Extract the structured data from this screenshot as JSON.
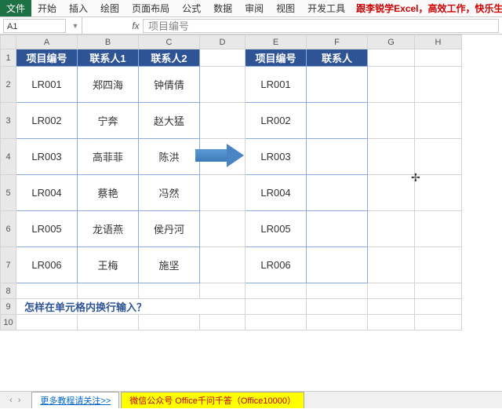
{
  "ribbon": {
    "tabs": [
      "文件",
      "开始",
      "插入",
      "绘图",
      "页面布局",
      "公式",
      "数据",
      "审阅",
      "视图",
      "开发工具"
    ],
    "extra": "跟李锐学Excel，高效工作，快乐生活！"
  },
  "namebox": {
    "cell": "A1",
    "fx": "fx",
    "formula": "项目编号"
  },
  "columns": [
    "A",
    "B",
    "C",
    "D",
    "E",
    "F",
    "G",
    "H"
  ],
  "rows": [
    "1",
    "2",
    "3",
    "4",
    "5",
    "6",
    "7",
    "8",
    "9",
    "10"
  ],
  "left_table": {
    "headers": [
      "项目编号",
      "联系人1",
      "联系人2"
    ],
    "rows": [
      [
        "LR001",
        "郑四海",
        "钟倩倩"
      ],
      [
        "LR002",
        "宁奔",
        "赵大猛"
      ],
      [
        "LR003",
        "高菲菲",
        "陈洪"
      ],
      [
        "LR004",
        "蔡艳",
        "冯然"
      ],
      [
        "LR005",
        "龙语燕",
        "侯丹河"
      ],
      [
        "LR006",
        "王梅",
        "施坚"
      ]
    ]
  },
  "right_table": {
    "headers": [
      "项目编号",
      "联系人"
    ],
    "rows": [
      [
        "LR001",
        ""
      ],
      [
        "LR002",
        ""
      ],
      [
        "LR003",
        ""
      ],
      [
        "LR004",
        ""
      ],
      [
        "LR005",
        ""
      ],
      [
        "LR006",
        ""
      ]
    ]
  },
  "question": "怎样在单元格内换行输入？",
  "sheet_tabs": {
    "nav": "‹ ›",
    "t1": "更多教程请关注>>",
    "t2": "微信公众号 Office千问千答（Office10000）"
  }
}
